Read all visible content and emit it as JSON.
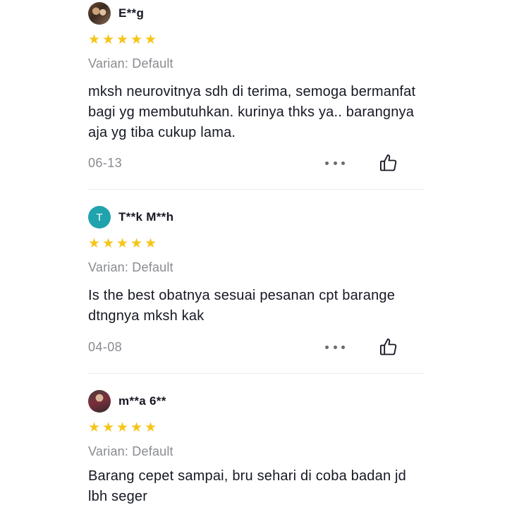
{
  "reviews": [
    {
      "username": "E**g",
      "avatar": "user-photo-avatar",
      "rating": 5,
      "variant": "Varian: Default",
      "text": "mksh neurovitnya sdh di terima, semoga bermanfat bagi yg membutuhkan. kurinya thks ya.. barangnya aja yg tiba cukup lama.",
      "date": "06-13"
    },
    {
      "username": "T**k M**h",
      "avatar_letter": "T",
      "avatar_color": "#1fa3ad",
      "rating": 5,
      "variant": "Varian: Default",
      "text": "Is the best obatnya sesuai pesanan cpt barange dtngnya mksh kak",
      "date": "04-08"
    },
    {
      "username": "m**a 6**",
      "avatar": "user-photo-avatar",
      "rating": 5,
      "variant": "Varian: Default",
      "text": "Barang cepet sampai, bru sehari di coba badan jd lbh seger"
    }
  ],
  "icons": {
    "star": "star-icon",
    "more": "more-options-icon",
    "like": "thumbs-up-icon"
  },
  "colors": {
    "star": "#f5c518",
    "avatar_teal": "#1fa3ad",
    "muted_text": "#8a8b91"
  }
}
